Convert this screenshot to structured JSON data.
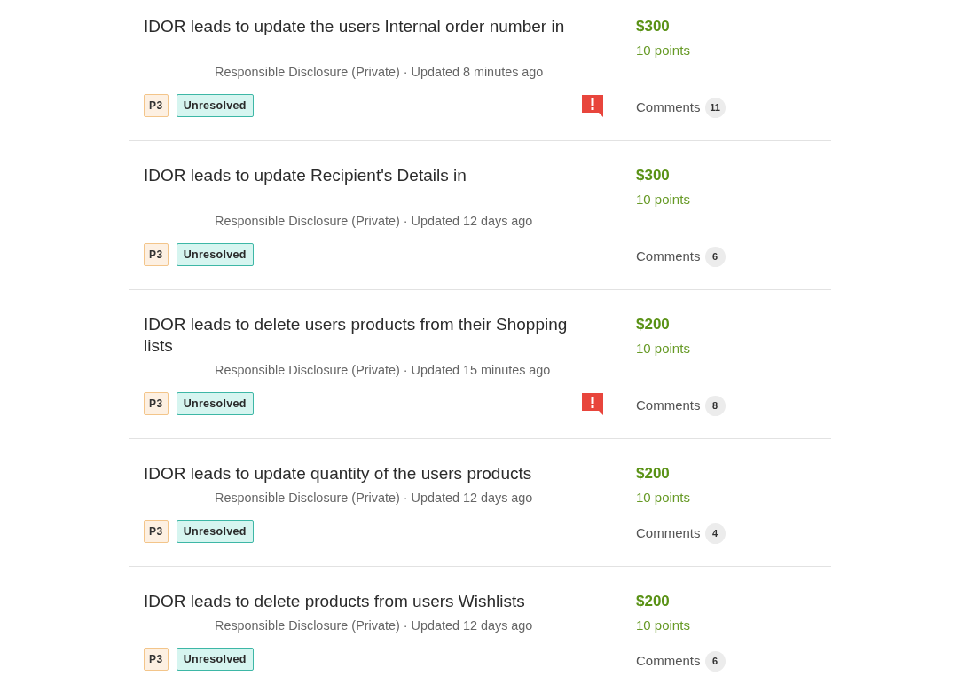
{
  "reports": [
    {
      "title": "IDOR leads to update the users Internal order number in",
      "erased_second_line": true,
      "meta": "Responsible Disclosure (Private) · Updated 8 minutes ago",
      "severity": "P3",
      "state": "Unresolved",
      "alert": true,
      "bounty": "$300",
      "points": "10 points",
      "comments_label": "Comments",
      "comments_count": "11"
    },
    {
      "title": "IDOR leads to update Recipient's Details in",
      "erased_second_line": true,
      "meta": "Responsible Disclosure (Private) · Updated 12 days ago",
      "severity": "P3",
      "state": "Unresolved",
      "alert": false,
      "bounty": "$300",
      "points": "10 points",
      "comments_label": "Comments",
      "comments_count": "6"
    },
    {
      "title": "IDOR leads to delete users products from their Shopping lists",
      "erased_second_line": false,
      "meta": "Responsible Disclosure (Private) · Updated 15 minutes ago",
      "severity": "P3",
      "state": "Unresolved",
      "alert": true,
      "bounty": "$200",
      "points": "10 points",
      "comments_label": "Comments",
      "comments_count": "8"
    },
    {
      "title": "IDOR leads to update quantity of the users products",
      "erased_second_line": false,
      "meta": "Responsible Disclosure (Private) · Updated 12 days ago",
      "severity": "P3",
      "state": "Unresolved",
      "alert": false,
      "bounty": "$200",
      "points": "10 points",
      "comments_label": "Comments",
      "comments_count": "4"
    },
    {
      "title": "IDOR leads to delete products from users Wishlists",
      "erased_second_line": false,
      "meta": "Responsible Disclosure (Private) · Updated 12 days ago",
      "severity": "P3",
      "state": "Unresolved",
      "alert": false,
      "bounty": "$200",
      "points": "10 points",
      "comments_label": "Comments",
      "comments_count": "6"
    }
  ]
}
